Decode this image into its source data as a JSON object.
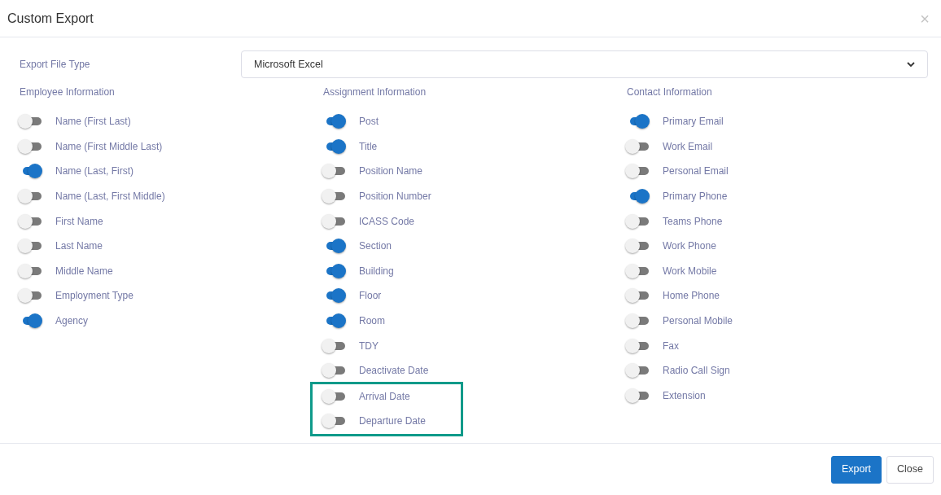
{
  "dialog": {
    "title": "Custom Export",
    "close_icon": "×"
  },
  "export_file_type": {
    "label": "Export File Type",
    "value": "Microsoft Excel"
  },
  "columns": [
    {
      "heading": "Employee Information",
      "items": [
        {
          "label": "Name (First Last)",
          "on": false,
          "highlighted": false
        },
        {
          "label": "Name (First Middle Last)",
          "on": false,
          "highlighted": false
        },
        {
          "label": "Name (Last, First)",
          "on": true,
          "highlighted": false
        },
        {
          "label": "Name (Last, First Middle)",
          "on": false,
          "highlighted": false
        },
        {
          "label": "First Name",
          "on": false,
          "highlighted": false
        },
        {
          "label": "Last Name",
          "on": false,
          "highlighted": false
        },
        {
          "label": "Middle Name",
          "on": false,
          "highlighted": false
        },
        {
          "label": "Employment Type",
          "on": false,
          "highlighted": false
        },
        {
          "label": "Agency",
          "on": true,
          "highlighted": false
        }
      ]
    },
    {
      "heading": "Assignment Information",
      "items": [
        {
          "label": "Post",
          "on": true,
          "highlighted": false
        },
        {
          "label": "Title",
          "on": true,
          "highlighted": false
        },
        {
          "label": "Position Name",
          "on": false,
          "highlighted": false
        },
        {
          "label": "Position Number",
          "on": false,
          "highlighted": false
        },
        {
          "label": "ICASS Code",
          "on": false,
          "highlighted": false
        },
        {
          "label": "Section",
          "on": true,
          "highlighted": false
        },
        {
          "label": "Building",
          "on": true,
          "highlighted": false
        },
        {
          "label": "Floor",
          "on": true,
          "highlighted": false
        },
        {
          "label": "Room",
          "on": true,
          "highlighted": false
        },
        {
          "label": "TDY",
          "on": false,
          "highlighted": false
        },
        {
          "label": "Deactivate Date",
          "on": false,
          "highlighted": false
        },
        {
          "label": "Arrival Date",
          "on": false,
          "highlighted": true
        },
        {
          "label": "Departure Date",
          "on": false,
          "highlighted": true
        }
      ]
    },
    {
      "heading": "Contact Information",
      "items": [
        {
          "label": "Primary Email",
          "on": true,
          "highlighted": false
        },
        {
          "label": "Work Email",
          "on": false,
          "highlighted": false
        },
        {
          "label": "Personal Email",
          "on": false,
          "highlighted": false
        },
        {
          "label": "Primary Phone",
          "on": true,
          "highlighted": false
        },
        {
          "label": "Teams Phone",
          "on": false,
          "highlighted": false
        },
        {
          "label": "Work Phone",
          "on": false,
          "highlighted": false
        },
        {
          "label": "Work Mobile",
          "on": false,
          "highlighted": false
        },
        {
          "label": "Home Phone",
          "on": false,
          "highlighted": false
        },
        {
          "label": "Personal Mobile",
          "on": false,
          "highlighted": false
        },
        {
          "label": "Fax",
          "on": false,
          "highlighted": false
        },
        {
          "label": "Radio Call Sign",
          "on": false,
          "highlighted": false
        },
        {
          "label": "Extension",
          "on": false,
          "highlighted": false
        }
      ]
    }
  ],
  "buttons": [
    {
      "label": "Export",
      "kind": "primary"
    },
    {
      "label": "Close",
      "kind": "secondary"
    }
  ]
}
